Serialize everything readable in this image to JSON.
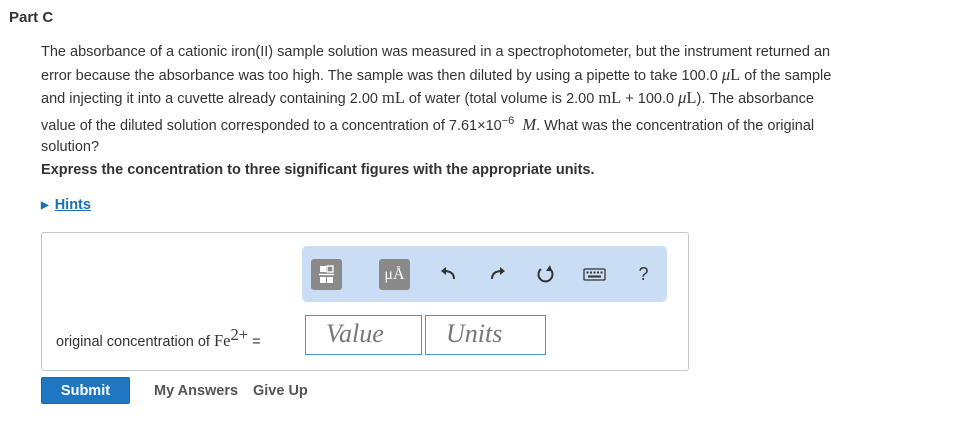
{
  "part": {
    "title": "Part C"
  },
  "question": {
    "l1": "The absorbance of a cationic iron(II) sample solution was measured in a spectrophotometer, but the instrument returned an",
    "l2a": "error because the absorbance was too high. The sample was then diluted by using a pipette to take 100.0 ",
    "mu": "μ",
    "L": "L",
    "l2b": " of the sample",
    "l3a": "and injecting it into a cuvette already containing 2.00 ",
    "mL": "mL",
    "l3b": " of water (total volume is 2.00 ",
    "l3c": " + 100.0 ",
    "l3d": "). The absorbance",
    "l4a": "value of the diluted solution corresponded to a concentration of 7.61×10",
    "l4exp": "−6",
    "M": "M",
    "l4b": ". What was the concentration of the original",
    "l5": "solution?"
  },
  "instruction": "Express the concentration to three significant figures with the appropriate units.",
  "hints": {
    "label": "Hints"
  },
  "toolbar": {
    "units_button": "μÅ",
    "help": "?",
    "icons": [
      "templates-icon",
      "units-icon",
      "undo-icon",
      "redo-icon",
      "reset-icon",
      "keyboard-icon",
      "help-icon"
    ]
  },
  "answer": {
    "label_prefix": "original concentration of ",
    "ion": "Fe",
    "charge": "2+",
    "equals": "=",
    "value_placeholder": "Value",
    "units_placeholder": "Units"
  },
  "actions": {
    "submit": "Submit",
    "my_answers": "My Answers",
    "give_up": "Give Up"
  },
  "colors": {
    "accent": "#1f76c2",
    "link": "#1a6fb5",
    "toolbar_bg": "#c9ddf4",
    "field_border": "#4a90d9"
  }
}
